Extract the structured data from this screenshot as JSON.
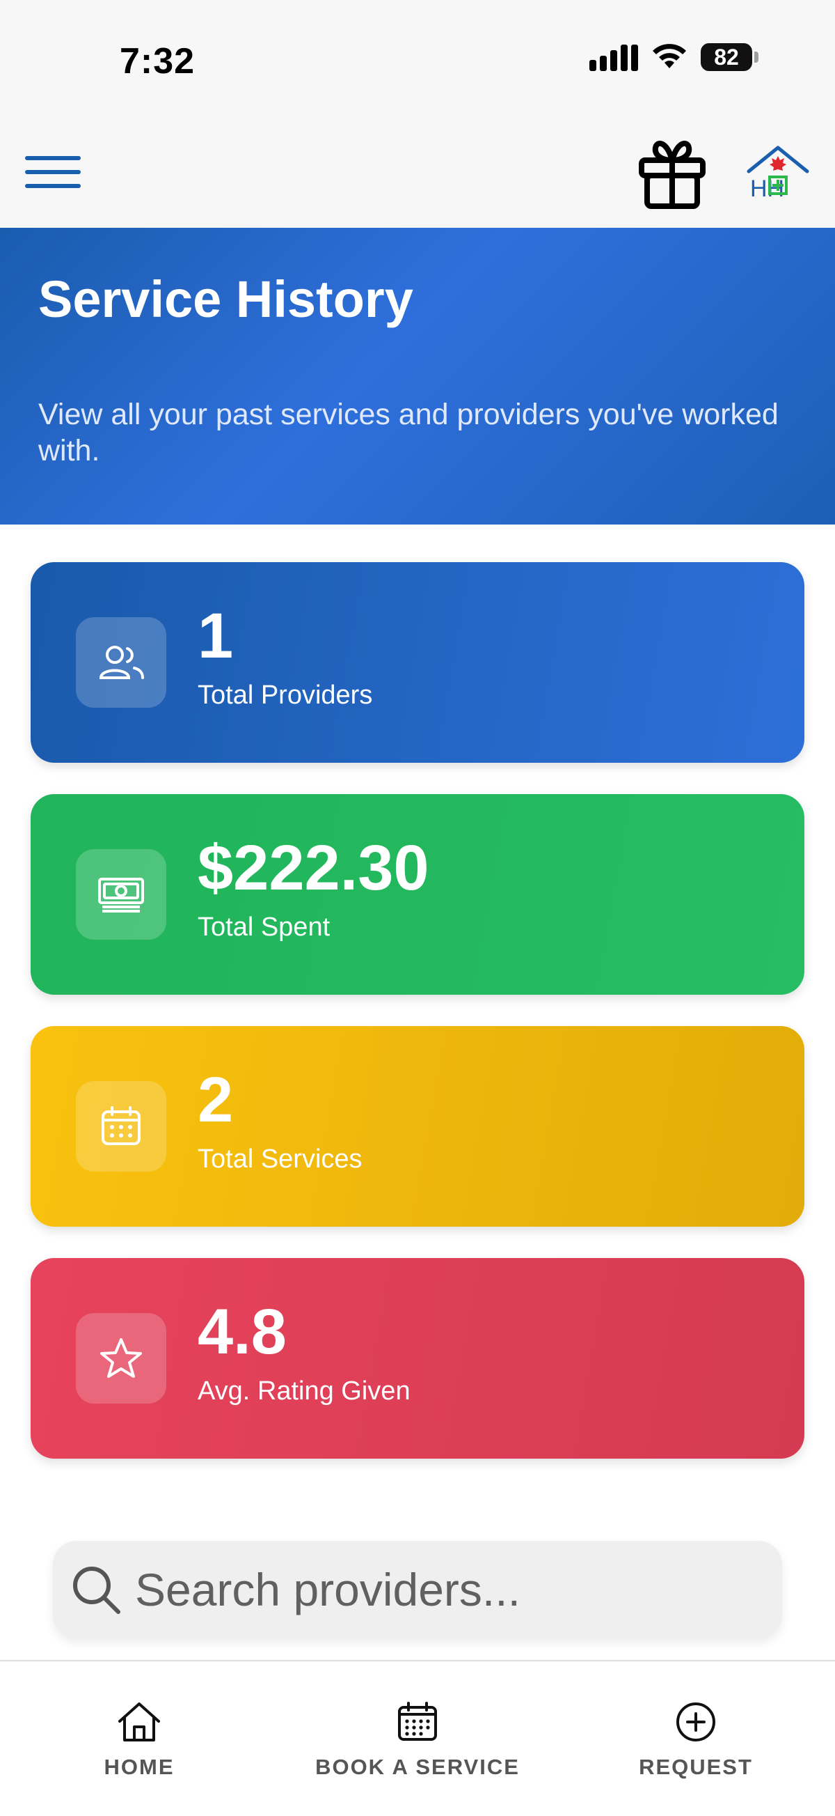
{
  "status_bar": {
    "time": "7:32",
    "battery": "82"
  },
  "header": {
    "menu_icon": "hamburger-menu-icon",
    "gift_icon": "gift-icon",
    "logo_icon": "home-health-logo",
    "logo_text": "HH",
    "brand_color": "#1a5fae",
    "logo_accent": "#2db84d",
    "logo_leaf": "#e0262e"
  },
  "hero": {
    "title": "Service History",
    "subtitle": "View all your past services and providers you've worked with.",
    "background": "#2f6fdc"
  },
  "stats": [
    {
      "value": "1",
      "label": "Total Providers",
      "icon": "users-icon",
      "color": "#1a5aab"
    },
    {
      "value": "$222.30",
      "label": "Total Spent",
      "icon": "money-icon",
      "color": "#21b45a"
    },
    {
      "value": "2",
      "label": "Total Services",
      "icon": "calendar-icon",
      "color": "#fac20e"
    },
    {
      "value": "4.8",
      "label": "Avg. Rating Given",
      "icon": "star-icon",
      "color": "#e7435c"
    }
  ],
  "search": {
    "placeholder": "Search providers...",
    "value": ""
  },
  "bottom_nav": {
    "items": [
      {
        "label": "HOME",
        "icon": "home-icon"
      },
      {
        "label": "BOOK A SERVICE",
        "icon": "calendar-icon"
      },
      {
        "label": "REQUEST",
        "icon": "plus-circle-icon"
      }
    ]
  }
}
